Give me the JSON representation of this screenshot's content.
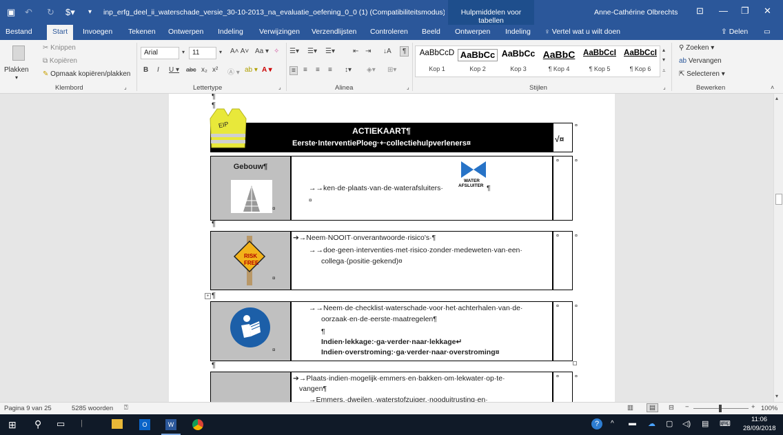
{
  "titlebar": {
    "doc_title": "inp_erfg_deel_ii_waterschade_versie_30-10-2013_na_evaluatie_oefening_0_0 (1) (Compatibiliteitsmodus) - W...",
    "tools_context": "Hulpmiddelen voor tabellen",
    "user": "Anne-Cathérine Olbrechts"
  },
  "tabs": [
    "Bestand",
    "Start",
    "Invoegen",
    "Tekenen",
    "Ontwerpen",
    "Indeling",
    "Verwijzingen",
    "Verzendlijsten",
    "Controleren",
    "Beeld",
    "Ontwerpen",
    "Indeling"
  ],
  "tell_me": "Vertel wat u wilt doen",
  "share": "Delen",
  "ribbon": {
    "clipboard": {
      "paste": "Plakken",
      "cut": "Knippen",
      "copy": "Kopiëren",
      "format_painter": "Opmaak kopiëren/plakken",
      "label": "Klembord"
    },
    "font": {
      "name": "Arial",
      "size": "11",
      "label": "Lettertype"
    },
    "paragraph": {
      "label": "Alinea"
    },
    "styles": {
      "label": "Stijlen",
      "items": [
        {
          "preview": "AaBbCcD",
          "name": "Kop 1"
        },
        {
          "preview": "AaBbCc",
          "name": "Kop 2"
        },
        {
          "preview": "AaBbCc",
          "name": "Kop 3"
        },
        {
          "preview": "AaBbC",
          "name": "¶ Kop 4"
        },
        {
          "preview": "AaBbCcI",
          "name": "¶ Kop 5"
        },
        {
          "preview": "AaBbCcI",
          "name": "¶ Kop 6"
        }
      ]
    },
    "editing": {
      "find": "Zoeken",
      "replace": "Vervangen",
      "select": "Selecteren",
      "label": "Bewerken"
    }
  },
  "document": {
    "pilcrow": "¶",
    "vest_label": "EIP",
    "header_title": "ACTIEKAART¶",
    "header_subtitle": "Eerste·InterventiePloeg·+·collectiehulpverleners¤",
    "check": "√¤",
    "cell_mark": "¤",
    "row1": {
      "heading": "Gebouw¶",
      "text": "→→ken·de·plaats·van·de·waterafsluiters·",
      "badge_line1": "WATER",
      "badge_line2": "AFSLUITER",
      "tail": "¶"
    },
    "row2": {
      "line1": "➔→Neem·NOOIT·onverantwoorde·risico's·¶",
      "line2": "→→doe·geen·interventies·met·risico·zonder·medeweten·van·een·",
      "line3": "collega·(positie·gekend)¤",
      "sign_line1": "RISK",
      "sign_line2": "FREE"
    },
    "row3": {
      "line1": "→→Neem·de·checklist·waterschade·voor·het·achterhalen·van·de·",
      "line2": "oorzaak·en·de·eerste·maatregelen¶",
      "line3": "¶",
      "line4": "Indien·lekkage:·ga·verder·naar·lekkage↵",
      "line5": "Indien·overstroming:·ga·verder·naar·overstroming¤"
    },
    "row4": {
      "line1": "➔→Plaats·indien·mogelijk·emmers·en·bakken·om·lekwater·op·te·",
      "line2": "vangen¶",
      "line3": "→Emmers,·dweilen,·waterstofzuiger,·nooduitrusting·en·"
    }
  },
  "status": {
    "page": "Pagina 9 van 25",
    "words": "5285 woorden",
    "zoom": "100%"
  },
  "taskbar": {
    "time": "11:06",
    "date": "28/09/2018"
  }
}
